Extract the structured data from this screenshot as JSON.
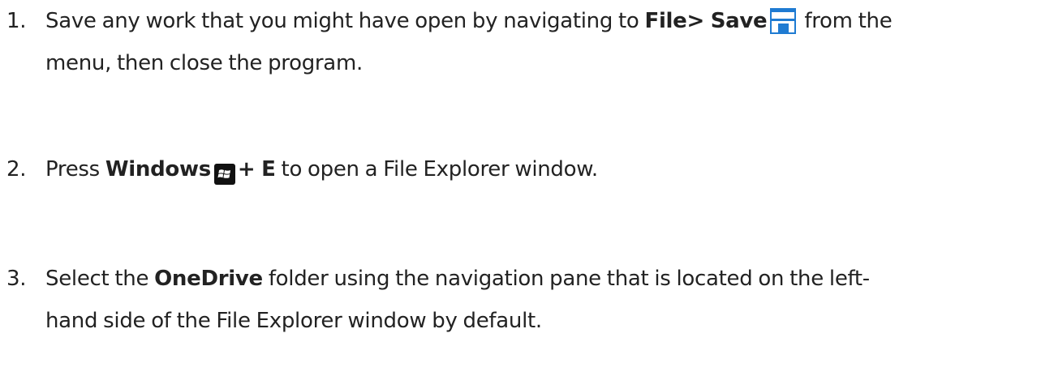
{
  "steps": [
    {
      "number": "1.",
      "text_a": "Save any work that you might have open by navigating to ",
      "bold_a": "File> Save",
      "icon": "save-icon",
      "text_b": " from the",
      "text_c": "menu, then close the program."
    },
    {
      "number": "2.",
      "text_a": "Press ",
      "bold_a": "Windows",
      "icon": "windows-key-icon",
      "bold_b": "+ E",
      "text_b": " to open a File Explorer window."
    },
    {
      "number": "3.",
      "text_a": "Select the ",
      "bold_a": "OneDrive",
      "text_b": " folder using the navigation pane that is located on the left-",
      "text_c": "hand side of the File Explorer window by default."
    }
  ],
  "colors": {
    "text": "#222222",
    "save_icon_blue": "#1f7bd2",
    "windows_icon_black": "#111111"
  }
}
